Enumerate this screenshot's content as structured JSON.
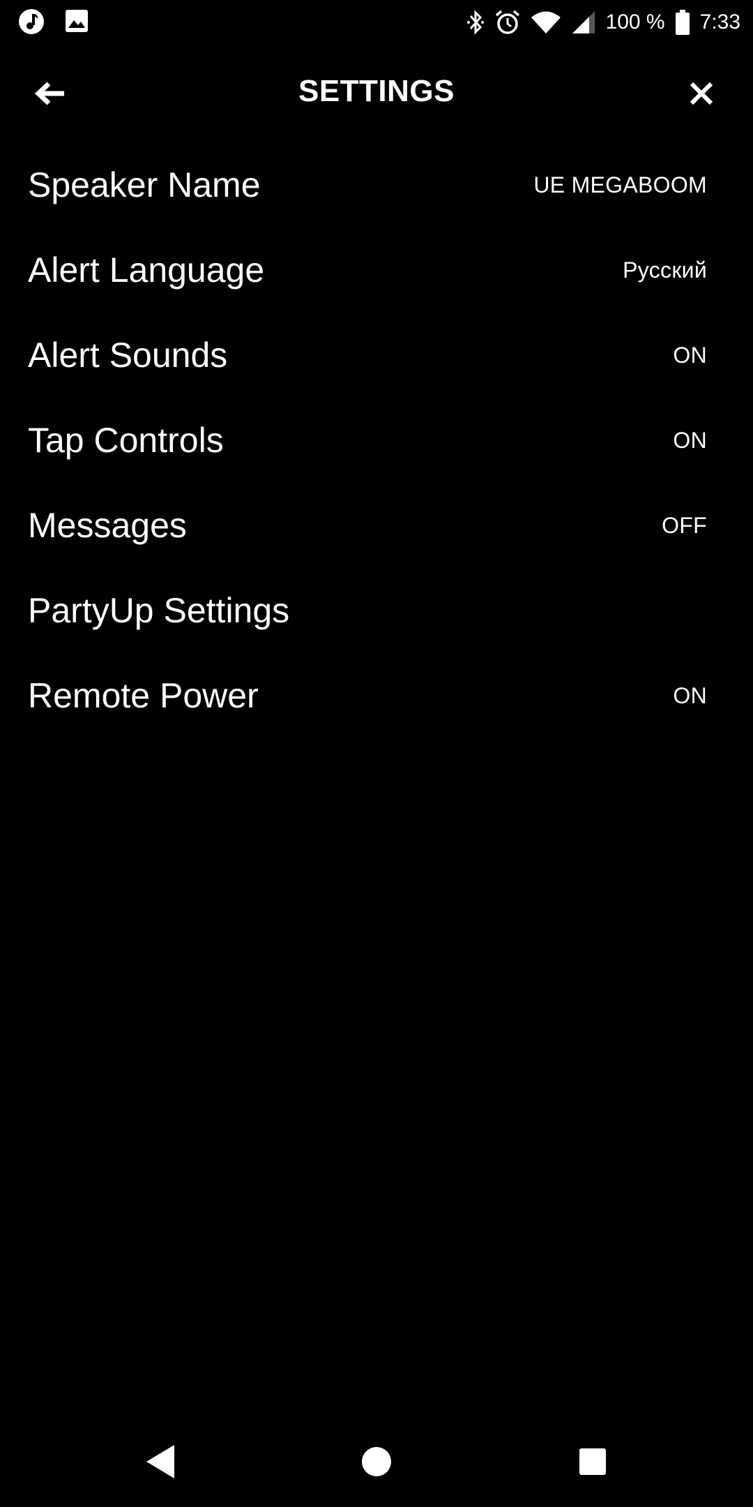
{
  "status_bar": {
    "battery": "100 %",
    "time": "7:33",
    "icons_left": [
      "music-notification-icon",
      "image-notification-icon"
    ],
    "icons_right": [
      "bluetooth-icon",
      "alarm-icon",
      "wifi-icon",
      "signal-icon",
      "battery-icon"
    ]
  },
  "header": {
    "title": "SETTINGS",
    "back_icon": "arrow-left-icon",
    "close_icon": "close-icon"
  },
  "settings": [
    {
      "label": "Speaker Name",
      "value": "UE MEGABOOM"
    },
    {
      "label": "Alert Language",
      "value": "Русский"
    },
    {
      "label": "Alert Sounds",
      "value": "ON"
    },
    {
      "label": "Tap Controls",
      "value": "ON"
    },
    {
      "label": "Messages",
      "value": "OFF"
    },
    {
      "label": "PartyUp Settings",
      "value": ""
    },
    {
      "label": "Remote Power",
      "value": "ON"
    }
  ],
  "nav_bar": {
    "icons": [
      "nav-back-icon",
      "nav-home-icon",
      "nav-recents-icon"
    ]
  },
  "colors": {
    "background": "#000000",
    "text": "#ffffff"
  }
}
